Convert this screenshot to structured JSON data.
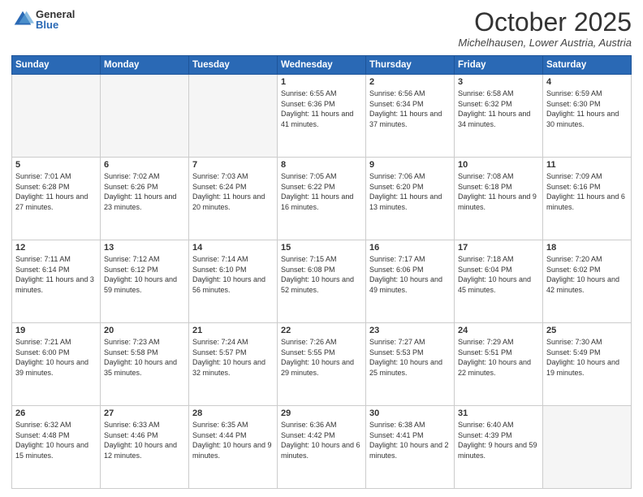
{
  "logo": {
    "general": "General",
    "blue": "Blue"
  },
  "title": "October 2025",
  "location": "Michelhausen, Lower Austria, Austria",
  "weekdays": [
    "Sunday",
    "Monday",
    "Tuesday",
    "Wednesday",
    "Thursday",
    "Friday",
    "Saturday"
  ],
  "weeks": [
    [
      {
        "day": "",
        "sunrise": "",
        "sunset": "",
        "daylight": ""
      },
      {
        "day": "",
        "sunrise": "",
        "sunset": "",
        "daylight": ""
      },
      {
        "day": "",
        "sunrise": "",
        "sunset": "",
        "daylight": ""
      },
      {
        "day": "1",
        "sunrise": "Sunrise: 6:55 AM",
        "sunset": "Sunset: 6:36 PM",
        "daylight": "Daylight: 11 hours and 41 minutes."
      },
      {
        "day": "2",
        "sunrise": "Sunrise: 6:56 AM",
        "sunset": "Sunset: 6:34 PM",
        "daylight": "Daylight: 11 hours and 37 minutes."
      },
      {
        "day": "3",
        "sunrise": "Sunrise: 6:58 AM",
        "sunset": "Sunset: 6:32 PM",
        "daylight": "Daylight: 11 hours and 34 minutes."
      },
      {
        "day": "4",
        "sunrise": "Sunrise: 6:59 AM",
        "sunset": "Sunset: 6:30 PM",
        "daylight": "Daylight: 11 hours and 30 minutes."
      }
    ],
    [
      {
        "day": "5",
        "sunrise": "Sunrise: 7:01 AM",
        "sunset": "Sunset: 6:28 PM",
        "daylight": "Daylight: 11 hours and 27 minutes."
      },
      {
        "day": "6",
        "sunrise": "Sunrise: 7:02 AM",
        "sunset": "Sunset: 6:26 PM",
        "daylight": "Daylight: 11 hours and 23 minutes."
      },
      {
        "day": "7",
        "sunrise": "Sunrise: 7:03 AM",
        "sunset": "Sunset: 6:24 PM",
        "daylight": "Daylight: 11 hours and 20 minutes."
      },
      {
        "day": "8",
        "sunrise": "Sunrise: 7:05 AM",
        "sunset": "Sunset: 6:22 PM",
        "daylight": "Daylight: 11 hours and 16 minutes."
      },
      {
        "day": "9",
        "sunrise": "Sunrise: 7:06 AM",
        "sunset": "Sunset: 6:20 PM",
        "daylight": "Daylight: 11 hours and 13 minutes."
      },
      {
        "day": "10",
        "sunrise": "Sunrise: 7:08 AM",
        "sunset": "Sunset: 6:18 PM",
        "daylight": "Daylight: 11 hours and 9 minutes."
      },
      {
        "day": "11",
        "sunrise": "Sunrise: 7:09 AM",
        "sunset": "Sunset: 6:16 PM",
        "daylight": "Daylight: 11 hours and 6 minutes."
      }
    ],
    [
      {
        "day": "12",
        "sunrise": "Sunrise: 7:11 AM",
        "sunset": "Sunset: 6:14 PM",
        "daylight": "Daylight: 11 hours and 3 minutes."
      },
      {
        "day": "13",
        "sunrise": "Sunrise: 7:12 AM",
        "sunset": "Sunset: 6:12 PM",
        "daylight": "Daylight: 10 hours and 59 minutes."
      },
      {
        "day": "14",
        "sunrise": "Sunrise: 7:14 AM",
        "sunset": "Sunset: 6:10 PM",
        "daylight": "Daylight: 10 hours and 56 minutes."
      },
      {
        "day": "15",
        "sunrise": "Sunrise: 7:15 AM",
        "sunset": "Sunset: 6:08 PM",
        "daylight": "Daylight: 10 hours and 52 minutes."
      },
      {
        "day": "16",
        "sunrise": "Sunrise: 7:17 AM",
        "sunset": "Sunset: 6:06 PM",
        "daylight": "Daylight: 10 hours and 49 minutes."
      },
      {
        "day": "17",
        "sunrise": "Sunrise: 7:18 AM",
        "sunset": "Sunset: 6:04 PM",
        "daylight": "Daylight: 10 hours and 45 minutes."
      },
      {
        "day": "18",
        "sunrise": "Sunrise: 7:20 AM",
        "sunset": "Sunset: 6:02 PM",
        "daylight": "Daylight: 10 hours and 42 minutes."
      }
    ],
    [
      {
        "day": "19",
        "sunrise": "Sunrise: 7:21 AM",
        "sunset": "Sunset: 6:00 PM",
        "daylight": "Daylight: 10 hours and 39 minutes."
      },
      {
        "day": "20",
        "sunrise": "Sunrise: 7:23 AM",
        "sunset": "Sunset: 5:58 PM",
        "daylight": "Daylight: 10 hours and 35 minutes."
      },
      {
        "day": "21",
        "sunrise": "Sunrise: 7:24 AM",
        "sunset": "Sunset: 5:57 PM",
        "daylight": "Daylight: 10 hours and 32 minutes."
      },
      {
        "day": "22",
        "sunrise": "Sunrise: 7:26 AM",
        "sunset": "Sunset: 5:55 PM",
        "daylight": "Daylight: 10 hours and 29 minutes."
      },
      {
        "day": "23",
        "sunrise": "Sunrise: 7:27 AM",
        "sunset": "Sunset: 5:53 PM",
        "daylight": "Daylight: 10 hours and 25 minutes."
      },
      {
        "day": "24",
        "sunrise": "Sunrise: 7:29 AM",
        "sunset": "Sunset: 5:51 PM",
        "daylight": "Daylight: 10 hours and 22 minutes."
      },
      {
        "day": "25",
        "sunrise": "Sunrise: 7:30 AM",
        "sunset": "Sunset: 5:49 PM",
        "daylight": "Daylight: 10 hours and 19 minutes."
      }
    ],
    [
      {
        "day": "26",
        "sunrise": "Sunrise: 6:32 AM",
        "sunset": "Sunset: 4:48 PM",
        "daylight": "Daylight: 10 hours and 15 minutes."
      },
      {
        "day": "27",
        "sunrise": "Sunrise: 6:33 AM",
        "sunset": "Sunset: 4:46 PM",
        "daylight": "Daylight: 10 hours and 12 minutes."
      },
      {
        "day": "28",
        "sunrise": "Sunrise: 6:35 AM",
        "sunset": "Sunset: 4:44 PM",
        "daylight": "Daylight: 10 hours and 9 minutes."
      },
      {
        "day": "29",
        "sunrise": "Sunrise: 6:36 AM",
        "sunset": "Sunset: 4:42 PM",
        "daylight": "Daylight: 10 hours and 6 minutes."
      },
      {
        "day": "30",
        "sunrise": "Sunrise: 6:38 AM",
        "sunset": "Sunset: 4:41 PM",
        "daylight": "Daylight: 10 hours and 2 minutes."
      },
      {
        "day": "31",
        "sunrise": "Sunrise: 6:40 AM",
        "sunset": "Sunset: 4:39 PM",
        "daylight": "Daylight: 9 hours and 59 minutes."
      },
      {
        "day": "",
        "sunrise": "",
        "sunset": "",
        "daylight": ""
      }
    ]
  ]
}
